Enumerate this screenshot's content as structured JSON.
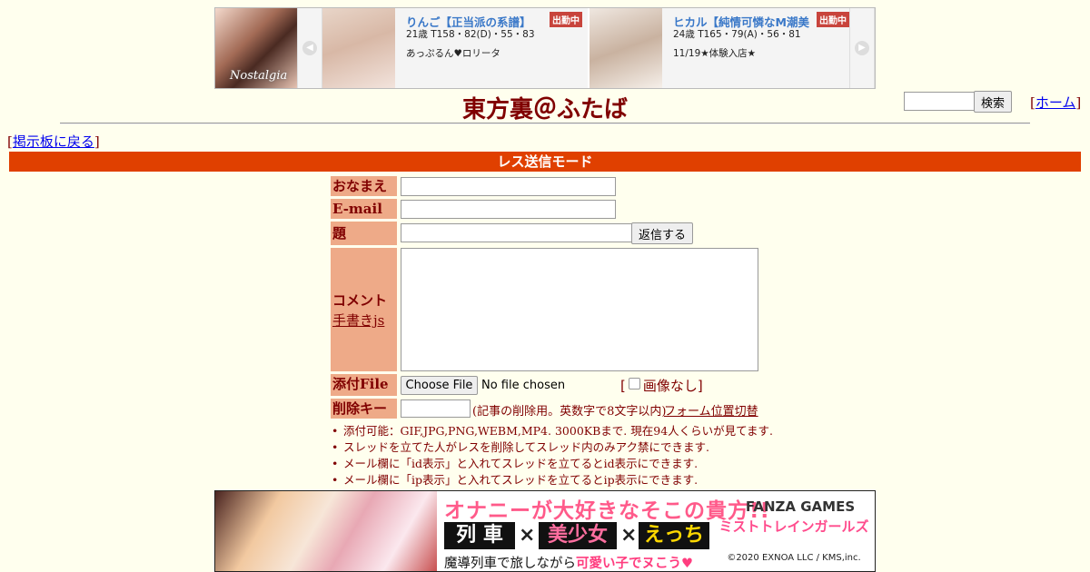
{
  "top_banner": {
    "logo_text": "Nostalgia",
    "prev_arrow": "◀",
    "next_arrow": "▶",
    "cards": [
      {
        "name": "りんご【正当派の系譜】",
        "status": "出勤中",
        "stats": "21歳 T158・82(D)・55・83",
        "comment": "あっぷるん♥ロリータ"
      },
      {
        "name": "ヒカル【純情可憐なM潮美",
        "status": "出勤中",
        "stats": "24歳 T165・79(A)・56・81",
        "comment": "11/19★体験入店★"
      }
    ]
  },
  "header": {
    "title": "東方裏＠ふたば",
    "search_button": "検索",
    "search_value": "",
    "home_link": "ホーム",
    "home_bracket_open": "[",
    "home_bracket_close": "]"
  },
  "nav": {
    "back_link": "掲示板に戻る",
    "bracket_open": "[",
    "bracket_close": "]"
  },
  "mode_bar": {
    "label": "レス送信モード"
  },
  "form": {
    "name_label": "おなまえ",
    "email_label": "E-mail",
    "subject_label": "題　名",
    "submit_button": "返信する",
    "comment_label": "コメント",
    "handwriting_link": "手書きjs",
    "file_label": "添付File",
    "file_button": "Choose File",
    "file_status": "No file chosen",
    "noimage_label": "画像なし",
    "noimage_bracket_open": "[",
    "noimage_bracket_close": "]",
    "delkey_label": "削除キー",
    "delkey_note": "(記事の削除用。英数字で8文字以内)",
    "form_toggle_link": "フォーム位置切替",
    "name_value": "",
    "email_value": "",
    "subject_value": "",
    "comment_value": "",
    "delkey_value": ""
  },
  "notices": [
    "添付可能：GIF,JPG,PNG,WEBM,MP4. 3000KBまで. 現在94人くらいが見てます.",
    "スレッドを立てた人がレスを削除してスレッド内のみアク禁にできます.",
    "メール欄に「id表示」と入れてスレッドを立てるとid表示にできます.",
    "メール欄に「ip表示」と入れてスレッドを立てるとip表示にできます."
  ],
  "bottom_ad": {
    "headline": "オナニーが大好きなそこの貴方!!",
    "word_1": "列 車",
    "word_2": "美少女",
    "word_3": "えっち",
    "times": "×",
    "tagline_prefix": "魔導列車で旅しながら",
    "tagline_emphasis": "可愛い子でヌこう♥",
    "brand": "FANZA GAMES",
    "game_title": "ミストトレインガールズ",
    "copyright": "©2020 EXNOA LLC / KMS,inc."
  },
  "colors": {
    "page_background": "#ffffee",
    "text": "#800000",
    "mode_bar": "#e04000",
    "label_cell": "#eeaa88",
    "link": "#0000ee",
    "profile_name": "#3a78c8",
    "status_badge": "#c8443c"
  }
}
